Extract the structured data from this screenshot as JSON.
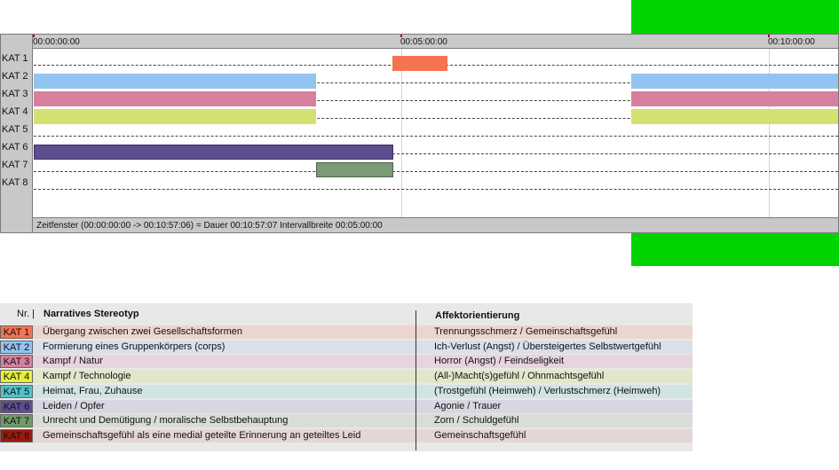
{
  "timeline": {
    "ticks": [
      "00:00:00:00",
      "00:05:00:00",
      "00:10:00:00"
    ],
    "rows": [
      "KAT 1",
      "KAT 2",
      "KAT 3",
      "KAT 4",
      "KAT 5",
      "KAT 6",
      "KAT 7",
      "KAT 8"
    ],
    "status": "Zeitfenster (00:00:00:00 -> 00:10:57:06) = Dauer 00:10:57:07    Intervallbreite 00:05:00:00",
    "colors": {
      "kat1": "#f47350",
      "kat2": "#93c3f0",
      "kat3": "#d7809e",
      "kat4": "#d4e170",
      "kat6": "#5e4e90",
      "kat7": "#7a9a78",
      "green": "#00d400"
    }
  },
  "legend": {
    "col_nr": "Nr. |",
    "col_stereotyp": "Narratives Stereotyp",
    "col_affekt": "Affektorientierung",
    "rows": [
      {
        "kat": "KAT 1",
        "stereotyp": "Übergang zwischen zwei Gesellschaftsformen",
        "affekt": "Trennungsschmerz / Gemeinschaftsgefühl",
        "color": "#f47350",
        "bg": "#ecd5cf"
      },
      {
        "kat": "KAT 2",
        "stereotyp": "Formierung eines Gruppenkörpers (corps)",
        "affekt": "Ich-Verlust (Angst) / Übersteigertes Selbstwertgefühl",
        "color": "#93c3f0",
        "bg": "#d8e0ea"
      },
      {
        "kat": "KAT 3",
        "stereotyp": "Kampf / Natur",
        "affekt": "Horror (Angst) / Feindseligkeit",
        "color": "#d7809e",
        "bg": "#e8d4dc"
      },
      {
        "kat": "KAT 4",
        "stereotyp": "Kampf / Technologie",
        "affekt": "(All-)Macht(s)gefühl / Ohnmachtsgefühl",
        "color": "#e4ef3c",
        "bg": "#e4e6cc"
      },
      {
        "kat": "KAT 5",
        "stereotyp": "Heimat, Frau, Zuhause",
        "affekt": "(Trostgefühl (Heimweh) / Verlustschmerz (Heimweh)",
        "color": "#4fc4c8",
        "bg": "#d0e4e4"
      },
      {
        "kat": "KAT 6",
        "stereotyp": "Leiden / Opfer",
        "affekt": "Agonie / Trauer",
        "color": "#5e4e90",
        "bg": "#d8d6e0"
      },
      {
        "kat": "KAT 7",
        "stereotyp": "Unrecht und Demütigung / moralische Selbstbehauptung",
        "affekt": "Zorn / Schuldgefühl",
        "color": "#6f9a6a",
        "bg": "#d8ddd6"
      },
      {
        "kat": "KAT 8",
        "stereotyp": "Gemeinschaftsgefühl als eine medial geteilte Erinnerung an geteiltes Leid",
        "affekt": "Gemeinschaftsgefühl",
        "color": "#a0180c",
        "bg": "#e4d6d6"
      }
    ]
  }
}
